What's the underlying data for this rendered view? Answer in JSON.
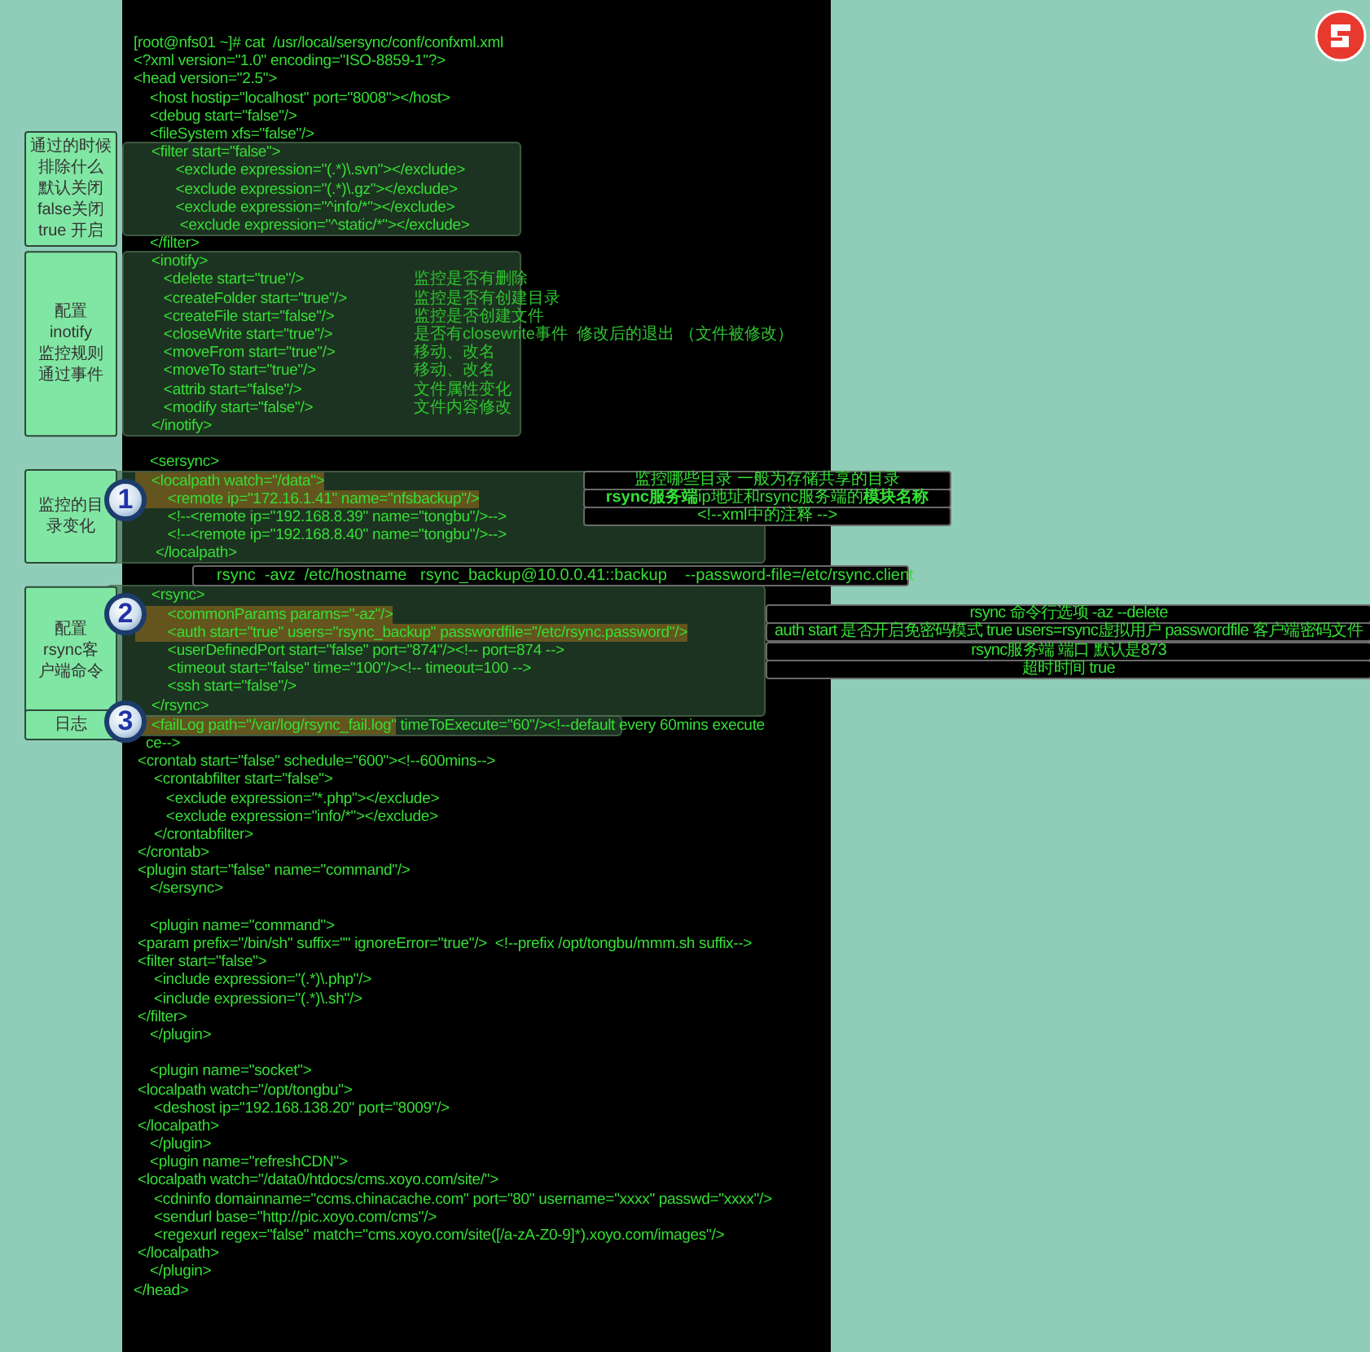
{
  "terminal": {
    "sections": [
      {
        "kind": "plain",
        "lines": [
          {
            "text": "[root@nfs01 ~]# cat  /usr/local/sersync/conf/confxml.xml"
          },
          {
            "text": "<?xml version=\"1.0\" encoding=\"ISO-8859-1\"?>"
          },
          {
            "text": "<head version=\"2.5\">"
          },
          {
            "text": "    <host hostip=\"localhost\" port=\"8008\"></host>"
          },
          {
            "text": "    <debug start=\"false\"/>"
          },
          {
            "text": "    <fileSystem xfs=\"false\"/>"
          }
        ]
      },
      {
        "kind": "filter",
        "label": [
          "通过的时候",
          "排除什么",
          "默认关闭",
          "false关闭",
          "true 开启"
        ],
        "lines": [
          {
            "text": "    <filter start=\"false\">"
          },
          {
            "text": "          <exclude expression=\"(.*)\\.svn\"></exclude>"
          },
          {
            "text": "          <exclude expression=\"(.*)\\.gz\"></exclude>"
          },
          {
            "text": "          <exclude expression=\"^info/*\"></exclude>"
          },
          {
            "text": "           <exclude expression=\"^static/*\"></exclude>"
          }
        ]
      },
      {
        "kind": "plain",
        "lines": [
          {
            "text": "    </filter>"
          }
        ]
      },
      {
        "kind": "inotify",
        "label": [
          "配置",
          "inotify",
          "监控规则",
          "通过事件"
        ],
        "lines": [
          {
            "text": "    <inotify>"
          },
          {
            "text": "       <delete start=\"true\"/>",
            "note": "监控是否有删除"
          },
          {
            "text": "       <createFolder start=\"true\"/>",
            "note": "监控是否有创建目录"
          },
          {
            "text": "       <createFile start=\"false\"/>",
            "note": "监控是否创建文件"
          },
          {
            "text": "       <closeWrite start=\"true\"/>",
            "note": "是否有closewrite事件  修改后的退出 （文件被修改）"
          },
          {
            "text": "       <moveFrom start=\"true\"/>",
            "note": "移动、改名"
          },
          {
            "text": "       <moveTo start=\"true\"/>",
            "note": "移动、改名"
          },
          {
            "text": "       <attrib start=\"false\"/>",
            "note": "文件属性变化"
          },
          {
            "text": "       <modify start=\"false\"/>",
            "note": "文件内容修改"
          },
          {
            "text": "    </inotify>"
          }
        ]
      },
      {
        "kind": "plain",
        "gap_before": true,
        "lines": [
          {
            "text": "    <sersync>"
          }
        ]
      },
      {
        "kind": "localpath",
        "label": [
          "监控的目",
          "录变化"
        ],
        "badge": "1",
        "lines": [
          {
            "text": "    <localpath watch=\"/data\">",
            "olive": true,
            "callout": "监控哪些目录 一般为存储共享的目录"
          },
          {
            "text": "        <remote ip=\"172.16.1.41\" name=\"nfsbackup\"/>",
            "olive": true,
            "callout": "**rsync服务端**ip地址和rsync服务端的**模块名称**"
          },
          {
            "text": "        <!--<remote ip=\"192.168.8.39\" name=\"tongbu\"/>-->",
            "olive": false,
            "callout": "<!--xml中的注释 -->"
          },
          {
            "text": "        <!--<remote ip=\"192.168.8.40\" name=\"tongbu\"/>-->",
            "olive": false
          },
          {
            "text": "     </localpath>",
            "olive": false
          }
        ]
      },
      {
        "kind": "command",
        "command": "rsync  -avz  /etc/hostname   rsync_backup@10.0.0.41::backup    --password-file=/etc/rsync.client"
      },
      {
        "kind": "rsync",
        "label": [
          "配置",
          "rsync客",
          "户端命令"
        ],
        "badge": "2",
        "lines": [
          {
            "text": "    <rsync>",
            "olive": false
          },
          {
            "text": "        <commonParams params=\"-az\"/>",
            "olive": true,
            "callout": "rsync 命令行选项  -az  --delete"
          },
          {
            "text": "        <auth start=\"true\" users=\"rsync_backup\" passwordfile=\"/etc/rsync.password\"/>",
            "olive": true,
            "callout": "auth start 是否开启免密码模式 true users=rsync虚拟用户 passwordfile 客户端密码文件"
          },
          {
            "text": "        <userDefinedPort start=\"false\" port=\"874\"/><!-- port=874 -->",
            "olive": false,
            "callout": "rsync服务端 端口   默认是873"
          },
          {
            "text": "        <timeout start=\"false\" time=\"100\"/><!-- timeout=100 -->",
            "olive": false,
            "callout": "超时时间 true"
          },
          {
            "text": "        <ssh start=\"false\"/>",
            "olive": false
          },
          {
            "text": "    </rsync>",
            "olive": false
          }
        ]
      },
      {
        "kind": "faillog",
        "label": [
          "日志"
        ],
        "badge": "3",
        "lines": [
          {
            "olive_part": "    <failLog path=\"/var/log/rsync_fail.log\"",
            "text": " timeToExecute=\"60\"/><!--default every 60mins execute"
          }
        ]
      },
      {
        "kind": "plain",
        "lines": [
          {
            "text": "   ce-->"
          },
          {
            "text": " <crontab start=\"false\" schedule=\"600\"><!--600mins-->"
          },
          {
            "text": "     <crontabfilter start=\"false\">"
          },
          {
            "text": "        <exclude expression=\"*.php\"></exclude>"
          },
          {
            "text": "        <exclude expression=\"info/*\"></exclude>"
          },
          {
            "text": "     </crontabfilter>"
          },
          {
            "text": " </crontab>"
          },
          {
            "text": " <plugin start=\"false\" name=\"command\"/>"
          },
          {
            "text": "    </sersync>"
          }
        ]
      },
      {
        "kind": "plain",
        "gap_before": true,
        "lines": [
          {
            "text": "    <plugin name=\"command\">"
          },
          {
            "text": " <param prefix=\"/bin/sh\" suffix=\"\" ignoreError=\"true\"/>  <!--prefix /opt/tongbu/mmm.sh suffix-->"
          },
          {
            "text": " <filter start=\"false\">"
          },
          {
            "text": "     <include expression=\"(.*)\\.php\"/>"
          },
          {
            "text": "     <include expression=\"(.*)\\.sh\"/>"
          },
          {
            "text": " </filter>"
          },
          {
            "text": "    </plugin>"
          }
        ]
      },
      {
        "kind": "plain",
        "gap_before": true,
        "lines": [
          {
            "text": "    <plugin name=\"socket\">"
          },
          {
            "text": " <localpath watch=\"/opt/tongbu\">"
          },
          {
            "text": "     <deshost ip=\"192.168.138.20\" port=\"8009\"/>"
          },
          {
            "text": " </localpath>"
          },
          {
            "text": "    </plugin>"
          },
          {
            "text": "    <plugin name=\"refreshCDN\">"
          },
          {
            "text": " <localpath watch=\"/data0/htdocs/cms.xoyo.com/site/\">"
          },
          {
            "text": "     <cdninfo domainname=\"ccms.chinacache.com\" port=\"80\" username=\"xxxx\" passwd=\"xxxx\"/>"
          },
          {
            "text": "     <sendurl base=\"http://pic.xoyo.com/cms\"/>"
          },
          {
            "text": "     <regexurl regex=\"false\" match=\"cms.xoyo.com/site([/a-zA-Z0-9]*).xoyo.com/images\"/>"
          },
          {
            "text": " </localpath>"
          },
          {
            "text": "    </plugin>"
          },
          {
            "text": "</head>"
          }
        ]
      }
    ]
  }
}
